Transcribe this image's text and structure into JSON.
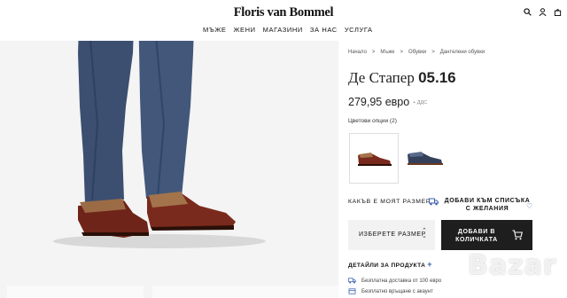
{
  "header": {
    "logo": "Floris van Bommel",
    "nav": [
      "МЪЖЕ",
      "ЖЕНИ",
      "МАГАЗИНИ",
      "ЗА НАС",
      "УСЛУГА"
    ]
  },
  "breadcrumb": [
    "Начало",
    ">",
    "Мъже",
    ">",
    "Обувки",
    ">",
    "Дантелени обувки"
  ],
  "product": {
    "title_main": "Де Стапер",
    "title_code": "05.16",
    "price": "279,95 евро",
    "vat_note": "+ ДДС",
    "color_options_label": "Цветови опции (2)"
  },
  "actions": {
    "size_guide": "КАКЪВ Е МОЯТ РАЗМЕР",
    "wishlist": "ДОБАВИ КЪМ СПИСЪКА С ЖЕЛАНИЯ",
    "size_select": "ИЗБЕРЕТЕ РАЗМЕР",
    "add_to_cart": "ДОБАВИ В КОЛИЧКАТА"
  },
  "details": {
    "label": "ДЕТАЙЛИ ЗА ПРОДУКТА",
    "plus": "+"
  },
  "perks": [
    "Безплатна доставка от 100 евро",
    "Безплатно връщане с акаунт"
  ],
  "watermark": "Bazar",
  "colors": {
    "accent": "#3a5fb0",
    "button": "#1e1e1e",
    "shoe_brown": "#6e2418",
    "jeans": "#3c4f70"
  }
}
